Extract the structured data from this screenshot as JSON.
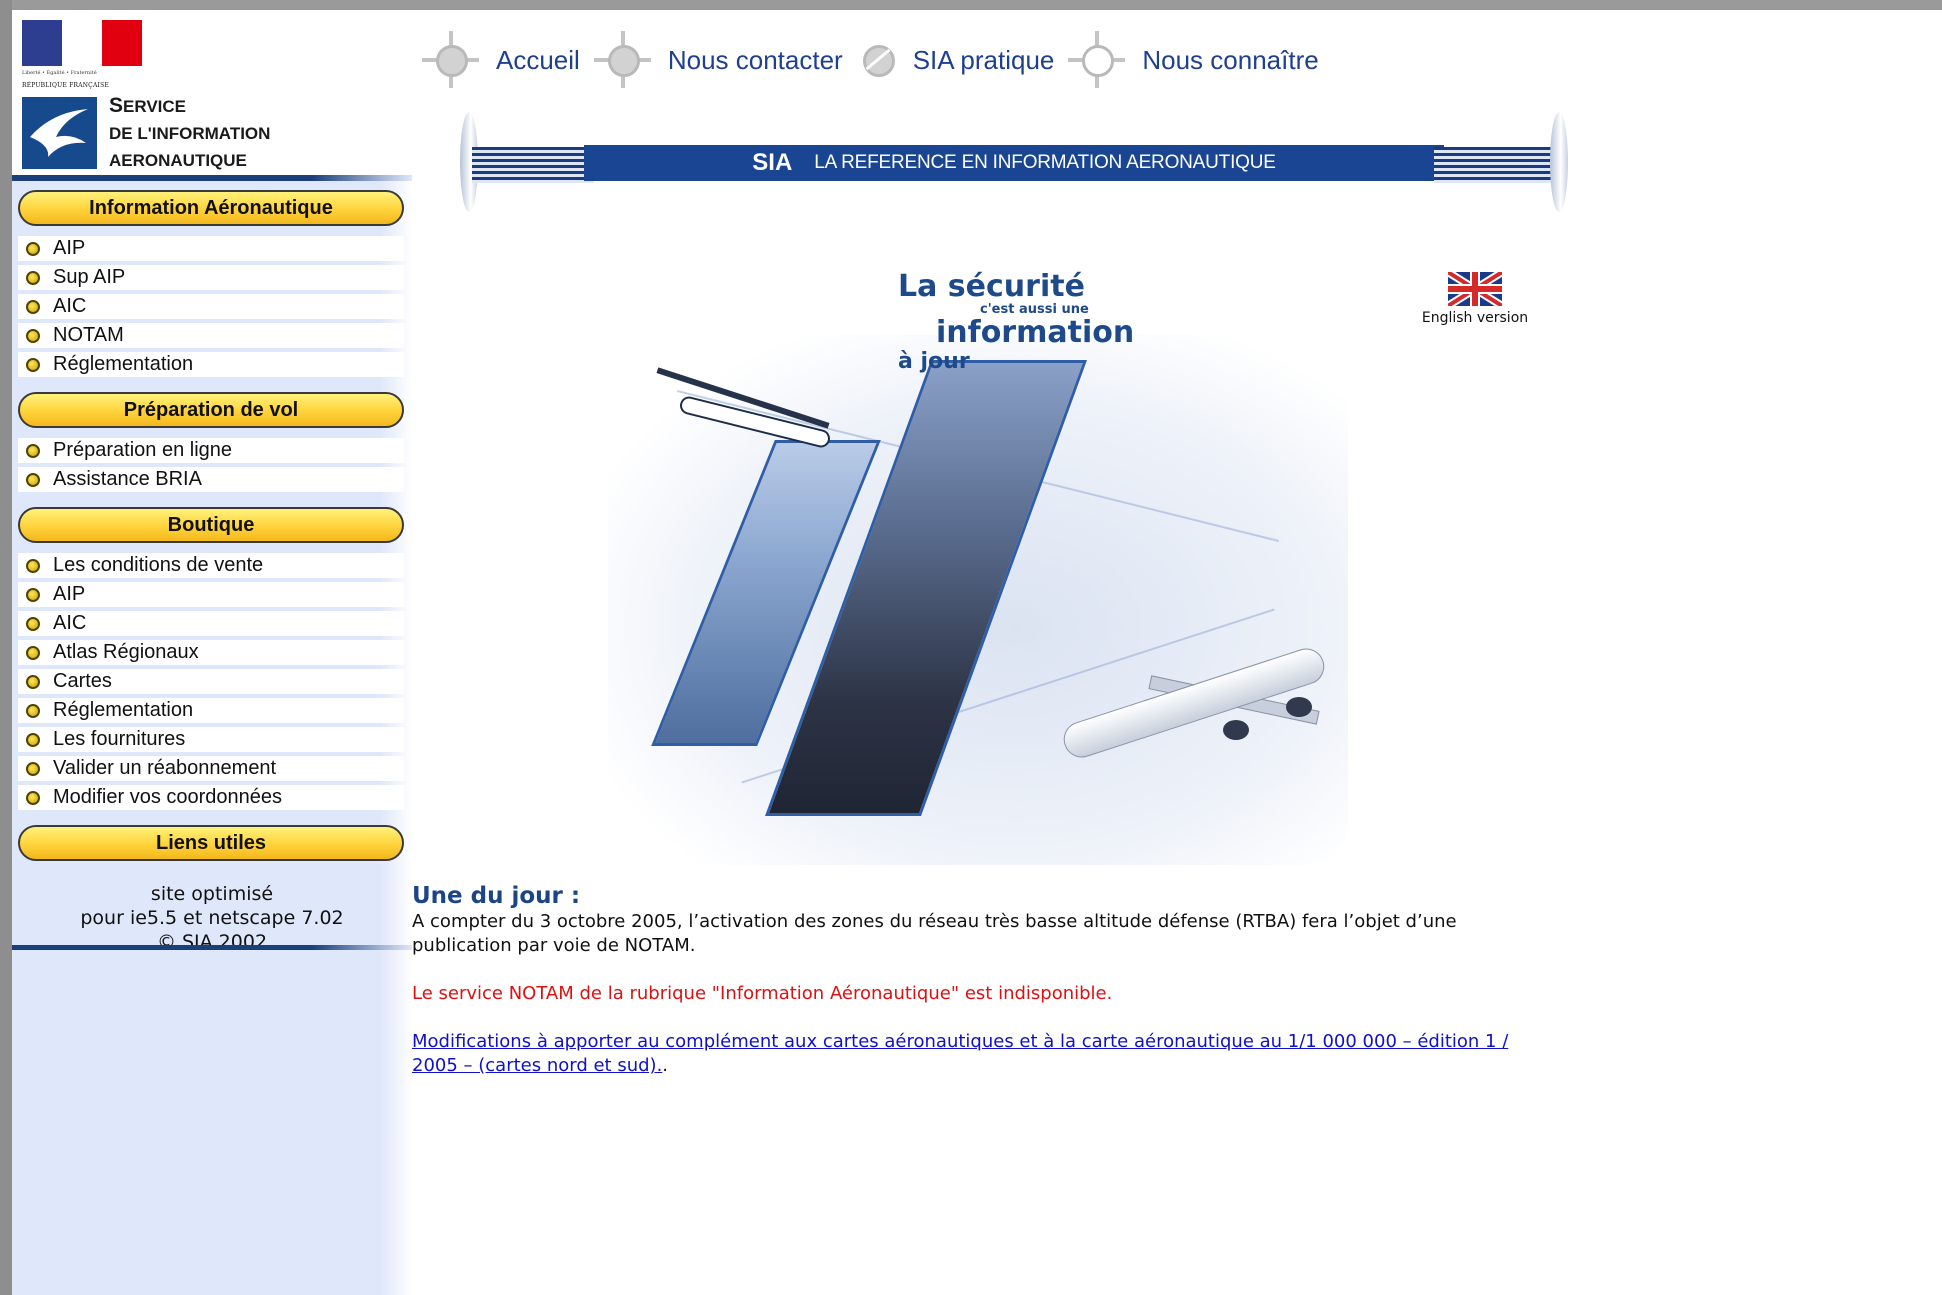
{
  "header": {
    "republic": {
      "motto": "Liberté • Égalité • Fraternité",
      "name": "RÉPUBLIQUE FRANÇAISE",
      "flag_colors": [
        "#2d3d8f",
        "#ffffff",
        "#e1000f"
      ]
    },
    "service_title": {
      "line1_initial": "S",
      "line1_rest": "ERVICE",
      "line2": "DE L'INFORMATION",
      "line3": "AERONAUTIQUE"
    }
  },
  "nav": {
    "items": [
      {
        "label": "Accueil",
        "icon": "compass-icon"
      },
      {
        "label": "Nous contacter",
        "icon": "compass-icon"
      },
      {
        "label": "SIA pratique",
        "icon": "circle-slash-icon"
      },
      {
        "label": "Nous connaître",
        "icon": "compass-icon"
      }
    ]
  },
  "banner": {
    "acronym": "SIA",
    "tagline": "LA REFERENCE EN INFORMATION AERONAUTIQUE"
  },
  "hero": {
    "line1": "La sécurité",
    "line2": "c'est aussi une",
    "line3": "information",
    "line4": "à jour"
  },
  "english": {
    "label": "English version",
    "icon": "uk-flag-icon"
  },
  "sidebar": {
    "sections": [
      {
        "title": "Information Aéronautique",
        "items": [
          "AIP",
          "Sup AIP",
          "AIC",
          "NOTAM",
          "Réglementation"
        ]
      },
      {
        "title": "Préparation de vol",
        "items": [
          "Préparation en ligne",
          "Assistance BRIA"
        ]
      },
      {
        "title": "Boutique",
        "items": [
          "Les conditions de vente",
          "AIP",
          "AIC",
          "Atlas Régionaux",
          "Cartes",
          "Réglementation",
          "Les fournitures",
          "Valider un réabonnement",
          "Modifier vos coordonnées"
        ]
      },
      {
        "title": "Liens utiles",
        "items": []
      }
    ],
    "footer": {
      "line1": "site optimisé",
      "line2": "pour ie5.5 et netscape 7.02",
      "line3": "© SIA 2002"
    }
  },
  "news": {
    "heading": "Une du jour :",
    "paragraph1": "A compter du 3 octobre 2005, l’activation des zones du réseau très basse altitude défense (RTBA) fera l’objet d’une publication par voie de NOTAM.",
    "alert": "Le service NOTAM de la rubrique \"Information Aéronautique\" est indisponible.",
    "link": "Modifications à apporter au complément aux cartes aéronautiques et à la carte aéronautique au 1/1 000 000 – édition 1 / 2005 – (cartes nord et sud).",
    "link_suffix": "."
  },
  "colors": {
    "nav_text": "#1f3f8f",
    "banner_blue": "#1a4593",
    "pill_yellow": "#ffd23b",
    "alert_red": "#e01010",
    "link_blue": "#1010cc",
    "sidebar_bg": "#dfe7fb"
  }
}
